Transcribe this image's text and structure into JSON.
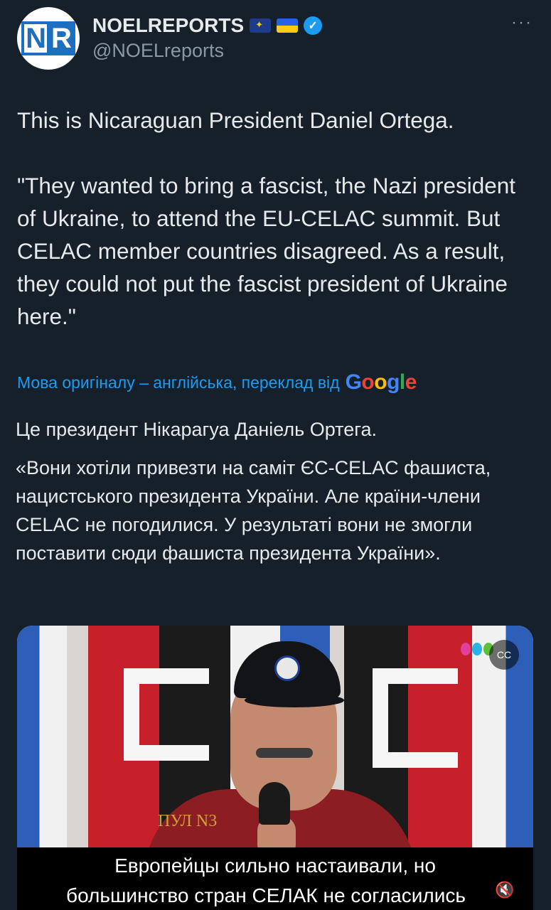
{
  "author": {
    "display_name": "NOELREPORTS",
    "handle": "@NOELreports",
    "avatar_text_left": "N",
    "avatar_text_right": "R",
    "badges": [
      "eu-flag-icon",
      "ukraine-flag-icon",
      "verified-badge-icon"
    ],
    "verified_color": "#1d9bf0"
  },
  "more_label": "···",
  "tweet": {
    "text": "This is Nicaraguan President Daniel Ortega.\n\n\"They wanted to bring a fascist, the Nazi president of Ukraine, to attend the EU-CELAC summit. But CELAC member countries disagreed. As a result, they could not put the fascist president of Ukraine here.\""
  },
  "translation": {
    "note": "Мова оригіналу – англійська, переклад від",
    "provider_letters": [
      "G",
      "o",
      "o",
      "g",
      "l",
      "e"
    ],
    "paragraph_1": "Це президент Нікарагуа Даніель Ортега.",
    "paragraph_2": "«Вони хотіли привезти на саміт ЄС-CELAC фашиста, нацистського президента України. Але країни-члени CELAC не погодилися. У результаті вони не змогли поставити сюди фашиста президента України»."
  },
  "media": {
    "overlay_label": "ПУЛ N3",
    "subtitle_line_1": "Европейцы сильно настаивали, но",
    "subtitle_line_2": "большинство стран СЕЛАК не согласились",
    "cc_icon": "closed-captions-icon",
    "mute_icon": "volume-muted-icon"
  },
  "colors": {
    "background": "#15202b",
    "text": "#e7e9ea",
    "secondary": "#8b98a5",
    "link": "#1d9bf0"
  }
}
